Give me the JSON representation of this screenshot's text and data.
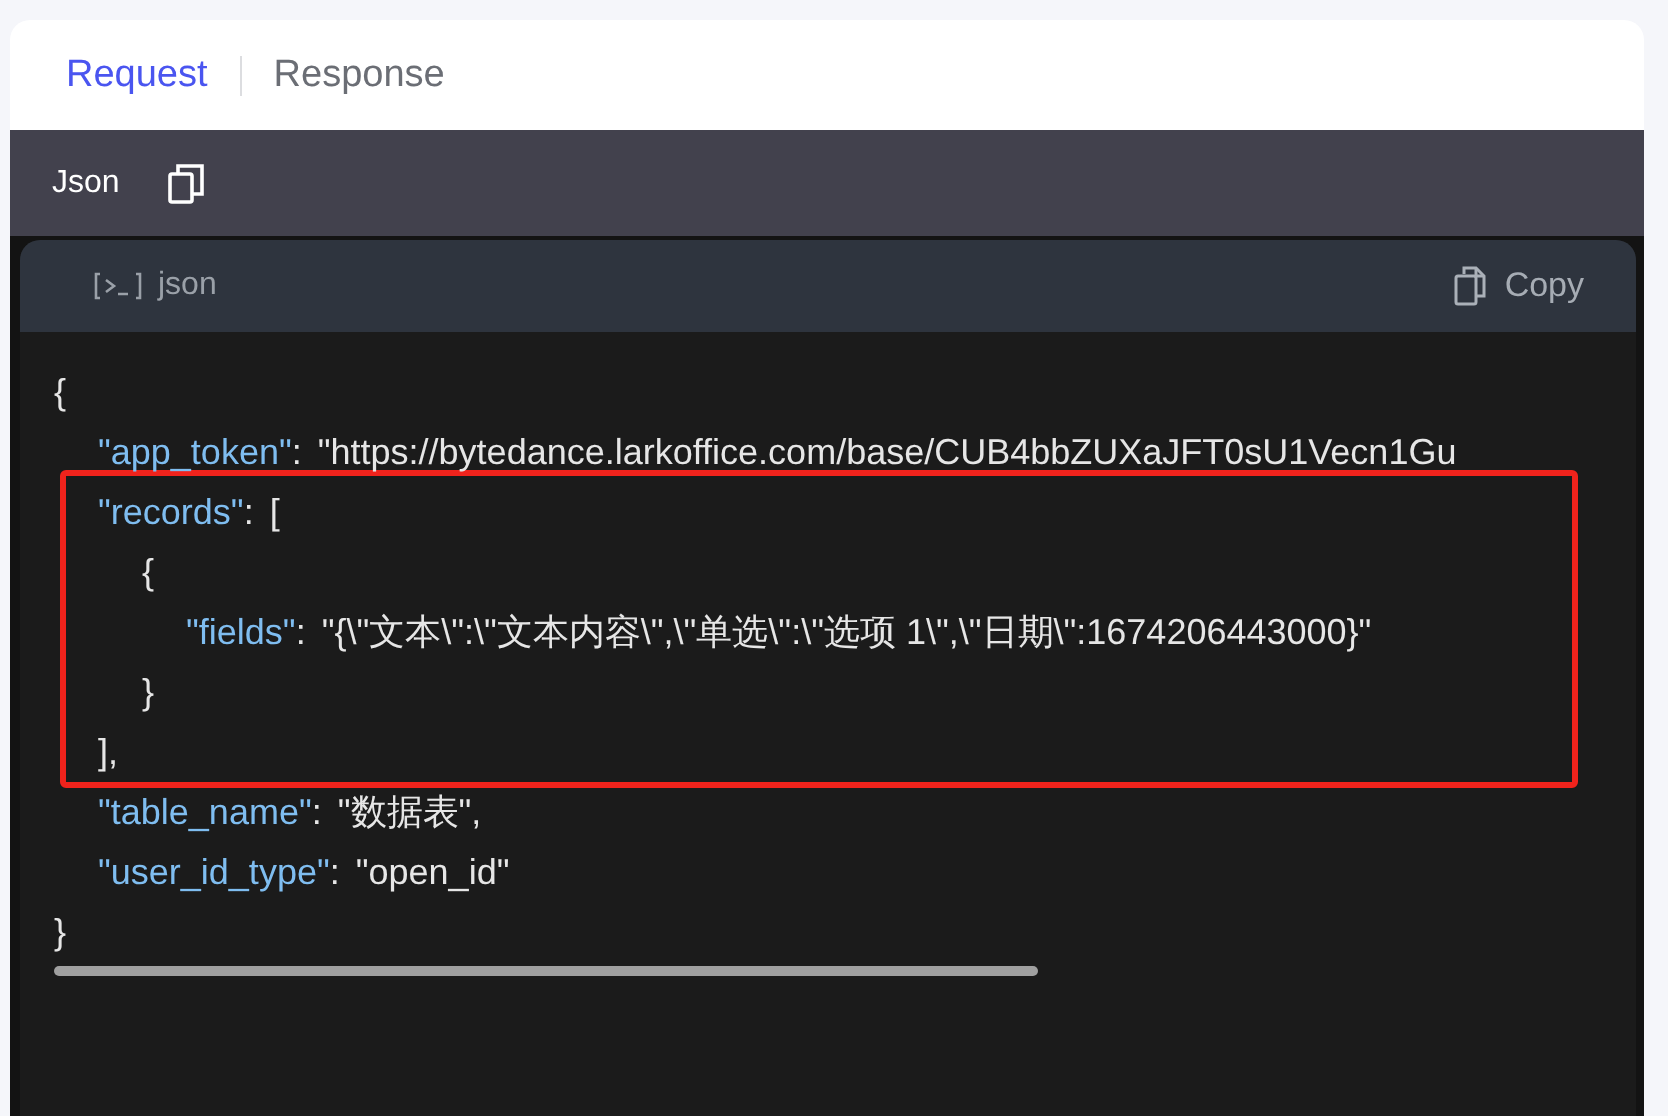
{
  "tabs": [
    {
      "label": "Request",
      "selected": true
    },
    {
      "label": "Response",
      "selected": false
    }
  ],
  "format_bar": {
    "label": "Json"
  },
  "code_panel": {
    "language": "json",
    "copy_label": "Copy",
    "code": {
      "open": "{",
      "close": "}",
      "children": [
        {
          "key": "\"app_token\"",
          "sep": ":",
          "value": "\"https://bytedance.larkoffice.com/base/CUB4bbZUXaJFT0sU1Vecn1Gu"
        },
        {
          "key": "\"records\"",
          "sep": ":",
          "open": "[",
          "close": "],",
          "highlighted": true,
          "children": [
            {
              "open": "{",
              "close": "}",
              "children": [
                {
                  "key": "\"fields\"",
                  "sep": ":",
                  "value": "\"{\\\"文本\\\":\\\"文本内容\\\",\\\"单选\\\":\\\"选项 1\\\",\\\"日期\\\":1674206443000}\""
                }
              ]
            }
          ]
        },
        {
          "key": "\"table_name\"",
          "sep": ":",
          "value": "\"数据表\","
        },
        {
          "key": "\"user_id_type\"",
          "sep": ":",
          "value": "\"open_id\""
        }
      ]
    }
  }
}
